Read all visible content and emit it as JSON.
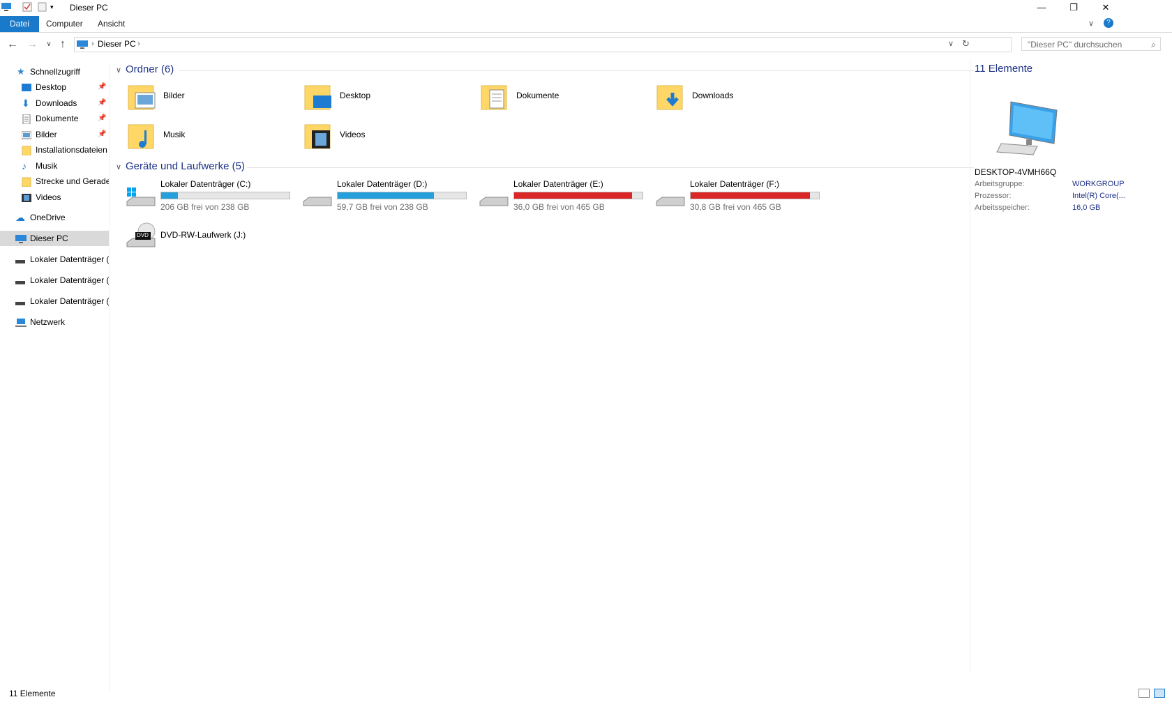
{
  "window": {
    "title": "Dieser PC"
  },
  "ribbon": {
    "tabs": [
      {
        "label": "Datei"
      },
      {
        "label": "Computer"
      },
      {
        "label": "Ansicht"
      }
    ]
  },
  "address": {
    "path": "Dieser PC",
    "search_placeholder": "\"Dieser PC\" durchsuchen"
  },
  "sidebar": {
    "items": [
      {
        "label": "Schnellzugriff"
      },
      {
        "label": "Desktop"
      },
      {
        "label": "Downloads"
      },
      {
        "label": "Dokumente"
      },
      {
        "label": "Bilder"
      },
      {
        "label": "Installationsdateien"
      },
      {
        "label": "Musik"
      },
      {
        "label": "Strecke und Gerade"
      },
      {
        "label": "Videos"
      },
      {
        "label": "OneDrive"
      },
      {
        "label": "Dieser PC"
      },
      {
        "label": "Lokaler Datenträger ("
      },
      {
        "label": "Lokaler Datenträger ("
      },
      {
        "label": "Lokaler Datenträger ("
      },
      {
        "label": "Netzwerk"
      }
    ]
  },
  "folders": {
    "heading": "Ordner (6)",
    "items": [
      {
        "label": "Bilder"
      },
      {
        "label": "Desktop"
      },
      {
        "label": "Dokumente"
      },
      {
        "label": "Downloads"
      },
      {
        "label": "Musik"
      },
      {
        "label": "Videos"
      }
    ]
  },
  "drives": {
    "heading": "Geräte und Laufwerke (5)",
    "items": [
      {
        "name": "Lokaler Datenträger (C:)",
        "free": "206 GB frei von 238 GB",
        "used_fraction": 0.13,
        "color": "#26a0da"
      },
      {
        "name": "Lokaler Datenträger (D:)",
        "free": "59,7 GB frei von 238 GB",
        "used_fraction": 0.75,
        "color": "#26a0da"
      },
      {
        "name": "Lokaler Datenträger (E:)",
        "free": "36,0 GB frei von 465 GB",
        "used_fraction": 0.92,
        "color": "#da2626"
      },
      {
        "name": "Lokaler Datenträger (F:)",
        "free": "30,8 GB frei von 465 GB",
        "used_fraction": 0.93,
        "color": "#da2626"
      }
    ],
    "dvd": {
      "name": "DVD-RW-Laufwerk (J:)",
      "badge": "DVD"
    }
  },
  "details": {
    "count": "11 Elemente",
    "computer_name": "DESKTOP-4VMH66Q",
    "props": [
      {
        "key": "Arbeitsgruppe:",
        "value": "WORKGROUP"
      },
      {
        "key": "Prozessor:",
        "value": "Intel(R) Core(..."
      },
      {
        "key": "Arbeitsspeicher:",
        "value": "16,0 GB"
      }
    ]
  },
  "status": {
    "count": "11 Elemente"
  }
}
